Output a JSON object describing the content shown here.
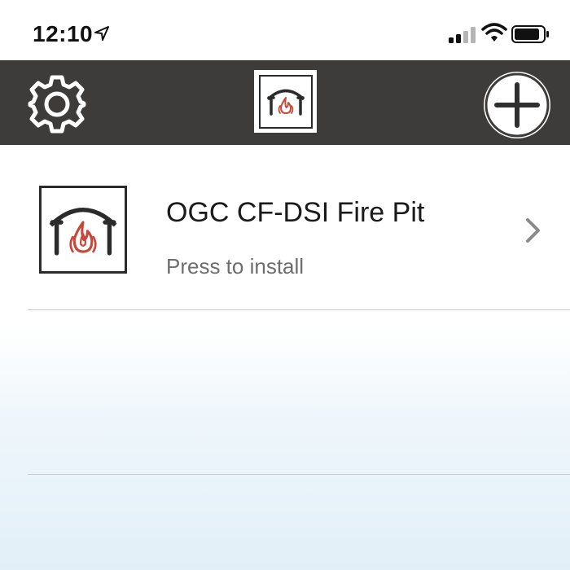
{
  "status_bar": {
    "time": "12:10",
    "icons": [
      "location-arrow-icon",
      "signal-icon",
      "wifi-icon",
      "battery-icon"
    ]
  },
  "nav_bar": {
    "left_icon": "gear-icon",
    "center_icon": "fire-pit-logo-icon",
    "right_icon": "plus-icon",
    "background_color": "#3d3c3b"
  },
  "devices": [
    {
      "name": "OGC CF-DSI Fire Pit",
      "subtitle": "Press to install",
      "icon": "fire-pit-logo-icon"
    }
  ],
  "colors": {
    "flame": "#c9473a",
    "subtitle_text": "#6d6d6d"
  }
}
